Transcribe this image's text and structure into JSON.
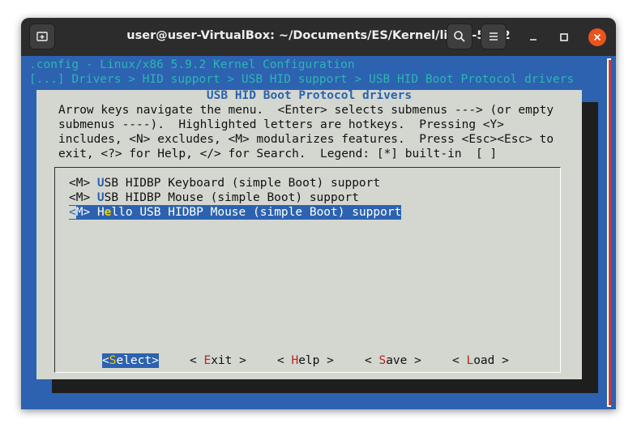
{
  "window": {
    "title": "user@user-VirtualBox: ~/Documents/ES/Kernel/linux-5.9.2",
    "new_tab_icon": "new-tab-icon",
    "search_icon": "search-icon",
    "menu_icon": "hamburger-menu-icon",
    "minimize_icon": "minimize-icon",
    "maximize_icon": "maximize-icon",
    "close_icon": "close-icon"
  },
  "terminal": {
    "header_line1": ".config - Linux/x86 5.9.2 Kernel Configuration",
    "header_line2": "[...] Drivers > HID support > USB HID support > USB HID Boot Protocol drivers"
  },
  "dialog": {
    "title": "USB HID Boot Protocol drivers",
    "help_lines": [
      "Arrow keys navigate the menu.  <Enter> selects submenus ---> (or empty",
      "submenus ----).  Highlighted letters are hotkeys.  Pressing <Y>",
      "includes, <N> excludes, <M> modularizes features.  Press <Esc><Esc> to",
      "exit, <?> for Help, </> for Search.  Legend: [*] built-in  [ ]"
    ],
    "items": [
      {
        "prefix": "<M> ",
        "hotkey": "U",
        "rest": "SB HIDBP Keyboard (simple Boot) support"
      },
      {
        "prefix": "<M> ",
        "hotkey": "U",
        "rest": "SB HIDBP Mouse (simple Boot) support"
      },
      {
        "cursor": "<",
        "prefix_rest": "M> ",
        "lead": "H",
        "hotkey": "e",
        "rest": "llo USB HIDBP Mouse (simple Boot) support"
      }
    ],
    "buttons": [
      {
        "pre": "<",
        "hotkey": "S",
        "rest": "elect>"
      },
      {
        "pre": "< ",
        "hotkey": "E",
        "rest": "xit >"
      },
      {
        "pre": "< ",
        "hotkey": "H",
        "rest": "elp >"
      },
      {
        "pre": "< ",
        "hotkey": "S",
        "rest": "ave >"
      },
      {
        "pre": "< ",
        "hotkey": "L",
        "rest": "oad >"
      }
    ]
  },
  "colors": {
    "background": "#2c62b0",
    "dialog": "#d3d7cf",
    "header_text": "#2fb5b0",
    "hotkey_blue": "#2c62b0",
    "hotkey_red": "#c02020",
    "highlight_hotkey": "#f0d000",
    "close_button": "#e9541f"
  }
}
